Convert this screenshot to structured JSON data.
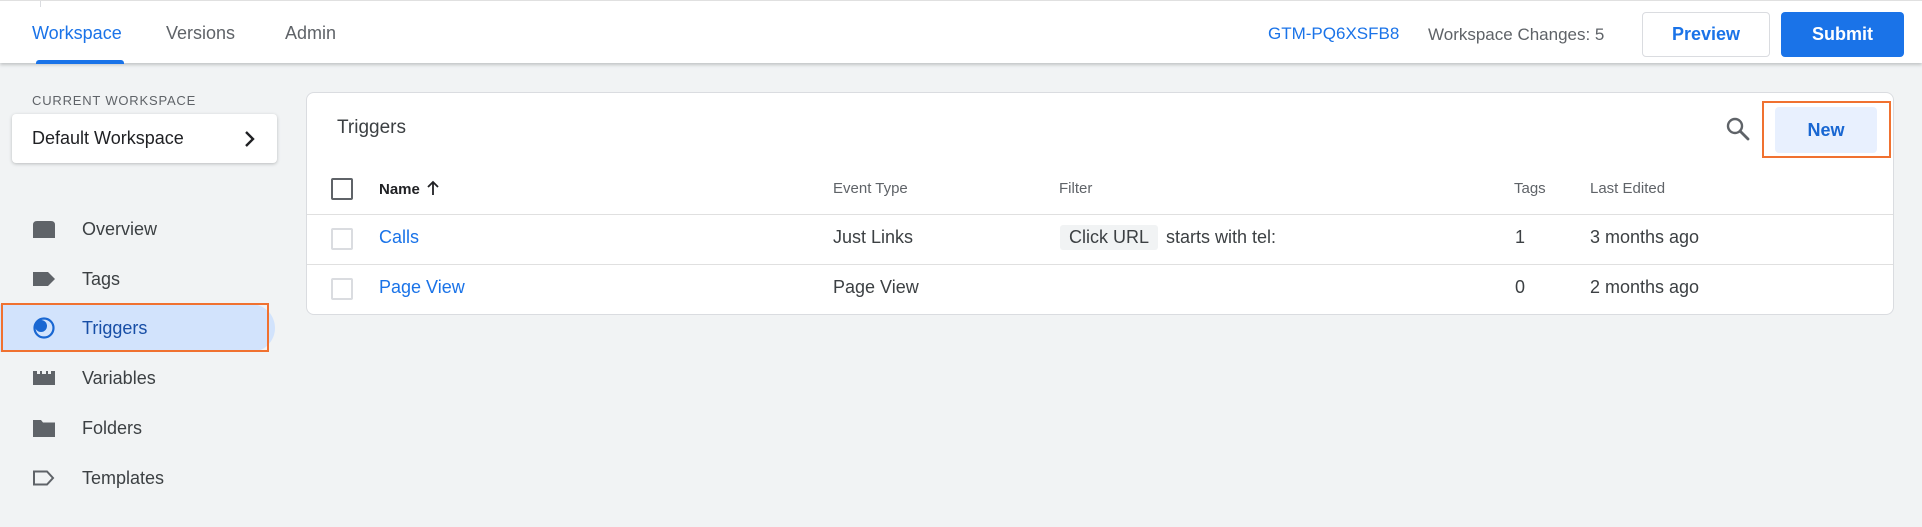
{
  "header": {
    "tabs": [
      {
        "label": "Workspace",
        "active": true
      },
      {
        "label": "Versions",
        "active": false
      },
      {
        "label": "Admin",
        "active": false
      }
    ],
    "container_id": "GTM-PQ6XSFB8",
    "workspace_changes": "Workspace Changes: 5",
    "preview_label": "Preview",
    "submit_label": "Submit"
  },
  "sidebar": {
    "current_workspace_label": "CURRENT WORKSPACE",
    "workspace_name": "Default Workspace",
    "items": [
      {
        "label": "Overview",
        "icon": "overview-icon",
        "active": false
      },
      {
        "label": "Tags",
        "icon": "tag-icon",
        "active": false
      },
      {
        "label": "Triggers",
        "icon": "trigger-icon",
        "active": true
      },
      {
        "label": "Variables",
        "icon": "variables-icon",
        "active": false
      },
      {
        "label": "Folders",
        "icon": "folder-icon",
        "active": false
      },
      {
        "label": "Templates",
        "icon": "template-icon",
        "active": false
      }
    ]
  },
  "main": {
    "title": "Triggers",
    "new_label": "New",
    "columns": {
      "name": "Name",
      "event_type": "Event Type",
      "filter": "Filter",
      "tags": "Tags",
      "last_edited": "Last Edited"
    },
    "rows": [
      {
        "name": "Calls",
        "event_type": "Just Links",
        "filter_variable": "Click URL",
        "filter_condition": "starts with tel:",
        "tags": "1",
        "last_edited": "3 months ago"
      },
      {
        "name": "Page View",
        "event_type": "Page View",
        "filter_variable": "",
        "filter_condition": "",
        "tags": "0",
        "last_edited": "2 months ago"
      }
    ]
  },
  "colors": {
    "accent": "#1a73e8",
    "highlight": "#f07130",
    "active_nav_bg": "#d2e3fc"
  }
}
